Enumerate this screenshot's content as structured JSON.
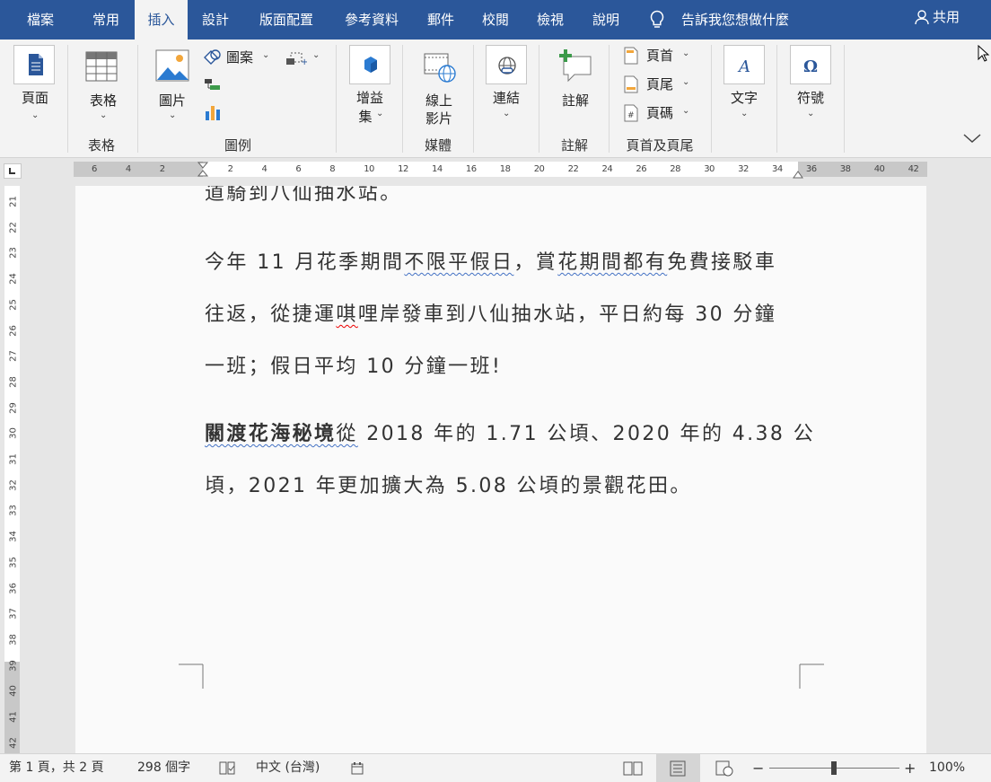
{
  "menu": {
    "tabs": [
      {
        "label": "檔案"
      },
      {
        "label": "常用"
      },
      {
        "label": "插入"
      },
      {
        "label": "設計"
      },
      {
        "label": "版面配置"
      },
      {
        "label": "參考資料"
      },
      {
        "label": "郵件"
      },
      {
        "label": "校閱"
      },
      {
        "label": "檢視"
      },
      {
        "label": "說明"
      }
    ],
    "active_tab": "插入",
    "tell_me": "告訴我您想做什麼",
    "share": "共用"
  },
  "ribbon": {
    "pages": {
      "label": "頁面"
    },
    "table": {
      "label": "表格",
      "group": "表格"
    },
    "pictures": {
      "label": "圖片"
    },
    "shapes": {
      "label": "圖案"
    },
    "illustrations_group": "圖例",
    "addins": {
      "label_line1": "增益",
      "label_line2": "集"
    },
    "online_video": {
      "label_line1": "線上",
      "label_line2": "影片",
      "group": "媒體"
    },
    "links": {
      "label": "連結"
    },
    "comment": {
      "label": "註解",
      "group": "註解"
    },
    "header": {
      "label": "頁首"
    },
    "footer": {
      "label": "頁尾"
    },
    "page_number": {
      "label": "頁碼"
    },
    "header_footer_group": "頁首及頁尾",
    "text": {
      "label": "文字"
    },
    "symbols": {
      "label": "符號"
    }
  },
  "ruler": {
    "h_ticks": [
      "6",
      "4",
      "2",
      "2",
      "4",
      "6",
      "8",
      "10",
      "12",
      "14",
      "16",
      "18",
      "20",
      "22",
      "24",
      "26",
      "28",
      "30",
      "32",
      "34",
      "36",
      "38",
      "40",
      "42"
    ],
    "v_ticks": [
      "21",
      "22",
      "23",
      "24",
      "25",
      "26",
      "27",
      "28",
      "29",
      "30",
      "31",
      "32",
      "33",
      "34",
      "35",
      "36",
      "37",
      "38",
      "39",
      "40",
      "41",
      "42"
    ]
  },
  "document": {
    "line0": "道騎到八仙抽水站。",
    "p1_line1_a": "今年 11 月花季期間",
    "p1_line1_sq1": "不限平假日",
    "p1_line1_b": "，賞",
    "p1_line1_sq2": "花期間都有",
    "p1_line1_c": "免費接駁車",
    "p1_line2_a": "往返，從捷運",
    "p1_line2_red": "唭",
    "p1_line2_b": "哩岸發車到八仙抽水站，平日約每 30 分鐘",
    "p1_line3": "一班；假日平均 10 分鐘一班!",
    "p2_line1_bold": "關渡花海秘境",
    "p2_line1_sq": "關渡花海秘境從",
    "p2_line1_rest": " 2018 年的 1.71 公頃、2020 年的 4.38 公",
    "p2_line2": "頃，2021 年更加擴大為 5.08 公頃的景觀花田。"
  },
  "status": {
    "page": "第 1 頁，共 2 頁",
    "words": "298 個字",
    "language": "中文 (台灣)",
    "zoom": "100%",
    "zoom_level_percent": 100
  }
}
